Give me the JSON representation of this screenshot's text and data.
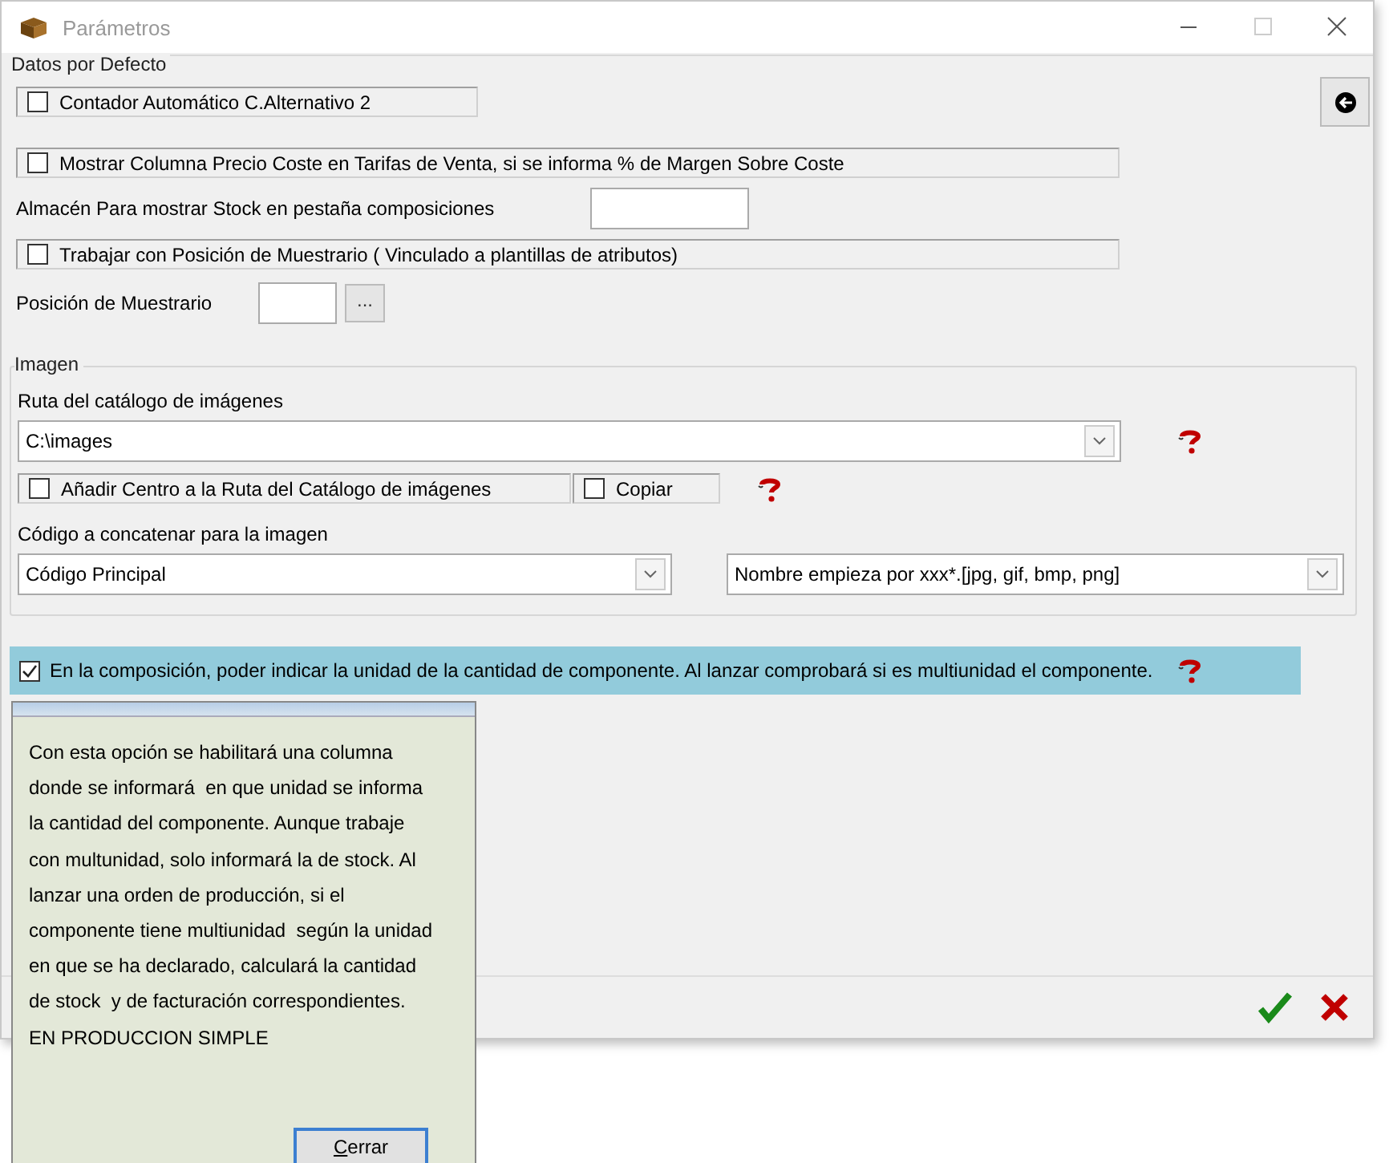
{
  "window": {
    "title": "Parámetros"
  },
  "defaults": {
    "legend": "Datos por Defecto",
    "items": [
      {
        "kind": "checkbox",
        "label": "Contador Automático C.Alternativo 2",
        "checked": false,
        "wide": false
      },
      {
        "kind": "checkbox",
        "label": "Mostrar Columna Precio Coste en Tarifas de Venta, si se informa % de Margen Sobre Coste",
        "checked": false,
        "wide": true
      },
      {
        "kind": "field",
        "label": "Almacén Para mostrar Stock en pestaña composiciones"
      },
      {
        "kind": "checkbox",
        "label": "Trabajar con Posición de Muestrario ( Vinculado a plantillas de atributos)",
        "checked": false,
        "wide": true
      },
      {
        "kind": "picker",
        "label": "Posición de Muestrario",
        "button": "..."
      }
    ]
  },
  "image": {
    "legend": "Imagen",
    "path_label": "Ruta del catálogo de imágenes",
    "path_value": "C:\\images",
    "add_center": {
      "label": "Añadir Centro a la Ruta del Catálogo de imágenes",
      "checked": false
    },
    "copy": {
      "label": "Copiar",
      "checked": false
    },
    "code_label": "Código a concatenar para la imagen",
    "code_value": "Código Principal",
    "name_value": "Nombre empieza por xxx*.[jpg, gif, bmp, png]"
  },
  "composition_option": {
    "label": "En la composición, poder indicar la unidad de la cantidad de componente. Al lanzar comprobará si es multiunidad el componente.",
    "checked": true,
    "selected": true
  },
  "help_popup": {
    "text": "Con esta opción se habilitará una columna donde se informará  en que unidad se informa la cantidad del componente. Aunque trabaje con multunidad, solo informará la de stock. Al lanzar una orden de producción, si el componente tiene multiunidad  según la unidad en que se ha declarado, calculará la cantidad de stock  y de facturación correspondientes. EN PRODUCCION SIMPLE",
    "button": "Cerrar"
  }
}
